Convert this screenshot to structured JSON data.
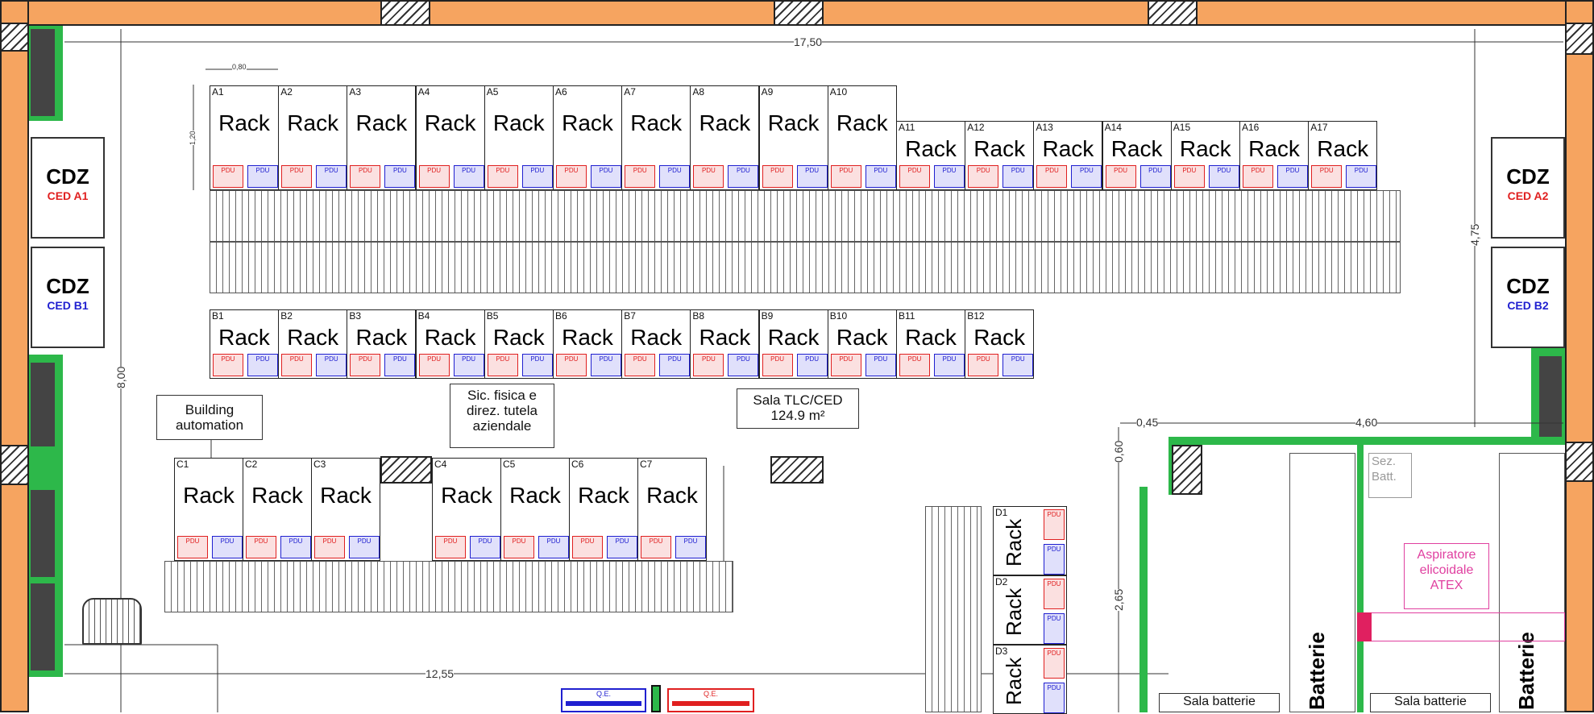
{
  "dimensions": {
    "top_width": "17,50",
    "room_depth": "8,00",
    "right_depth": "4,75",
    "room_bottom_width": "12,55",
    "battery_depth": "2,65",
    "battery_width": "4,60",
    "offset_a": "0,45",
    "offset_b": "0,60",
    "rack_width": "0,80",
    "rack_depth": "1,20"
  },
  "cdz_units": [
    {
      "title": "CDZ",
      "subtitle": "CED A1",
      "color": "#e02020"
    },
    {
      "title": "CDZ",
      "subtitle": "CED B1",
      "color": "#2020d0"
    },
    {
      "title": "CDZ",
      "subtitle": "CED A2",
      "color": "#e02020"
    },
    {
      "title": "CDZ",
      "subtitle": "CED B2",
      "color": "#2020d0"
    }
  ],
  "rack_text": "Rack",
  "row_a_large": [
    "A1",
    "A2",
    "A3",
    "A4",
    "A5",
    "A6",
    "A7",
    "A8",
    "A9",
    "A10"
  ],
  "row_a_small": [
    "A11",
    "A12",
    "A13",
    "A14",
    "A15",
    "A16",
    "A17"
  ],
  "row_b": [
    "B1",
    "B2",
    "B3",
    "B4",
    "B5",
    "B6",
    "B7",
    "B8",
    "B9",
    "B10",
    "B11",
    "B12"
  ],
  "row_c_left": [
    "C1",
    "C2",
    "C3"
  ],
  "row_c_right": [
    "C4",
    "C5",
    "C6",
    "C7"
  ],
  "row_d": [
    "D1",
    "D2",
    "D3"
  ],
  "pdu_text": "PDU",
  "notes": {
    "building_automation": "Building automation",
    "sic_fisica": "Sic. fisica e direz. tutela aziendale",
    "sala_tlc": "Sala TLC/CED",
    "sala_area": "124.9 m²",
    "sez_batt": "Sez. Batt.",
    "aspiratore": "Aspiratore elicoidale ATEX",
    "sala_batterie": "Sala batterie",
    "batterie": "Batterie",
    "qe": "Q.E."
  }
}
